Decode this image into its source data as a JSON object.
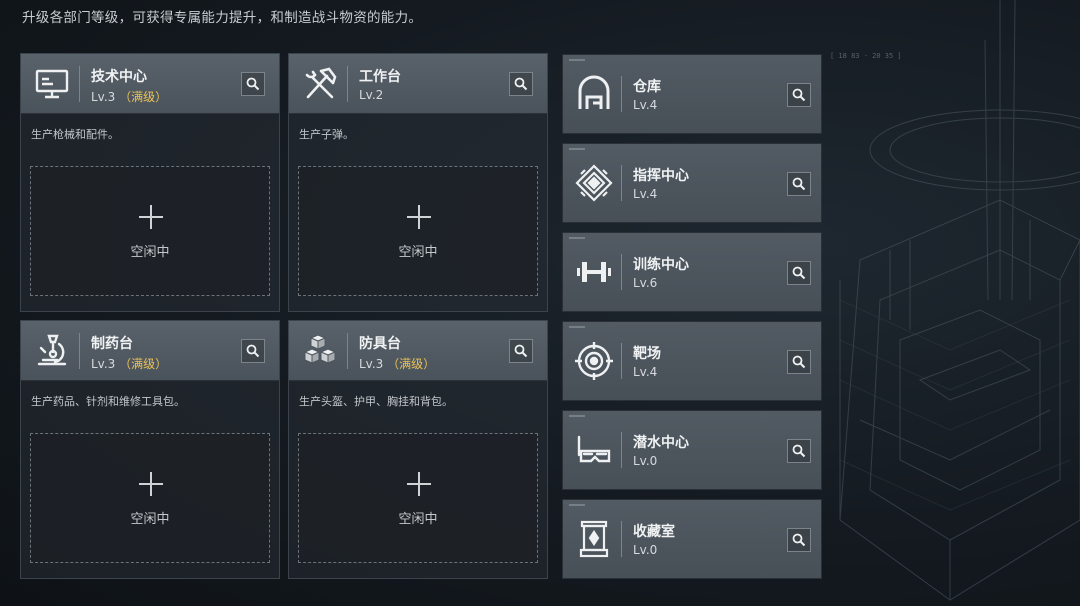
{
  "header": {
    "description": "升级各部门等级，可获得专属能力提升，和制造战斗物资的能力。"
  },
  "coords_readout": "[ 18 83 - 20 35 ]",
  "production": [
    {
      "name": "技术中心",
      "level": "Lv.3",
      "max_tag": "（满级）",
      "desc": "生产枪械和配件。",
      "slot_status": "空闲中",
      "icon": "computer-icon"
    },
    {
      "name": "工作台",
      "level": "Lv.2",
      "max_tag": "",
      "desc": "生产子弹。",
      "slot_status": "空闲中",
      "icon": "tools-icon"
    },
    {
      "name": "制药台",
      "level": "Lv.3",
      "max_tag": "（满级）",
      "desc": "生产药品、针剂和维修工具包。",
      "slot_status": "空闲中",
      "icon": "microscope-icon"
    },
    {
      "name": "防具台",
      "level": "Lv.3",
      "max_tag": "（满级）",
      "desc": "生产头盔、护甲、胸挂和背包。",
      "slot_status": "空闲中",
      "icon": "cubes-icon"
    }
  ],
  "facilities": [
    {
      "name": "仓库",
      "level": "Lv.4",
      "icon": "warehouse-icon"
    },
    {
      "name": "指挥中心",
      "level": "Lv.4",
      "icon": "command-emblem-icon"
    },
    {
      "name": "训练中心",
      "level": "Lv.6",
      "icon": "dumbbell-icon"
    },
    {
      "name": "靶场",
      "level": "Lv.4",
      "icon": "target-icon"
    },
    {
      "name": "潜水中心",
      "level": "Lv.0",
      "icon": "diving-mask-icon"
    },
    {
      "name": "收藏室",
      "level": "Lv.0",
      "icon": "display-case-icon"
    }
  ],
  "colors": {
    "accent_max": "#e8c25a",
    "panel": "#4a535b"
  }
}
